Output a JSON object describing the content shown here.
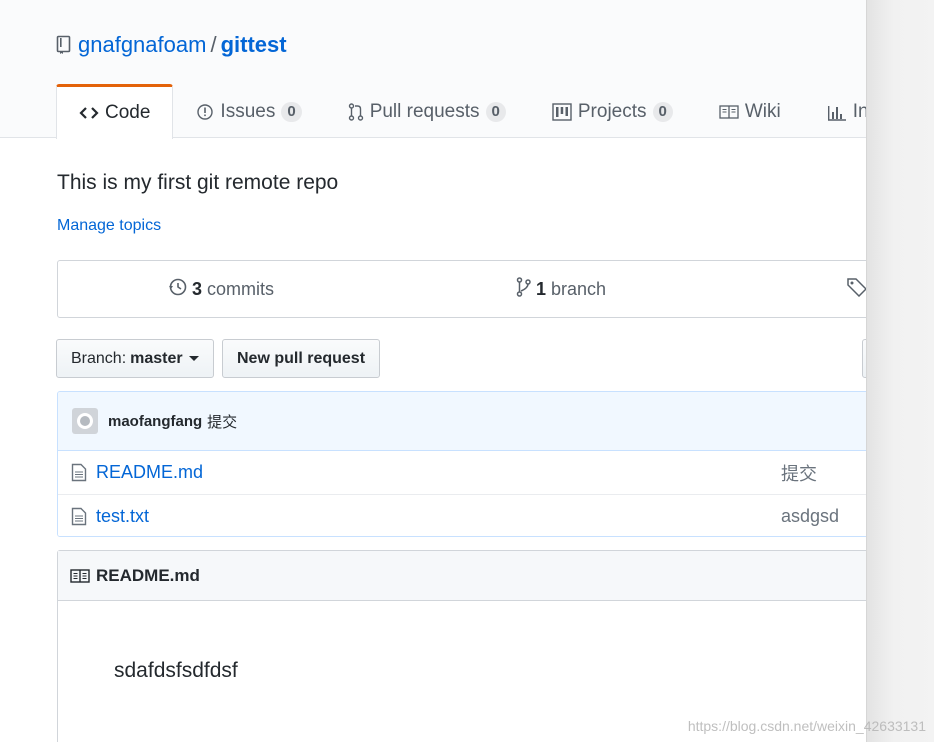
{
  "repo": {
    "owner": "gnafgnafoam",
    "separator": "/",
    "name": "gittest"
  },
  "tabs": [
    {
      "label": "Code",
      "icon": "code-icon",
      "count": null
    },
    {
      "label": "Issues",
      "icon": "issue-icon",
      "count": "0"
    },
    {
      "label": "Pull requests",
      "icon": "pull-request-icon",
      "count": "0"
    },
    {
      "label": "Projects",
      "icon": "project-icon",
      "count": "0"
    },
    {
      "label": "Wiki",
      "icon": "book-icon",
      "count": null
    },
    {
      "label": "Ins",
      "icon": "graph-icon",
      "count": null
    }
  ],
  "description": "This is my first git remote repo",
  "manage_topics": "Manage topics",
  "summary": {
    "commits_count": "3",
    "commits_label": "commits",
    "branch_count": "1",
    "branch_label": "branch"
  },
  "branch_button": {
    "prefix": "Branch:",
    "name": "master"
  },
  "new_pr_label": "New pull request",
  "latest_commit": {
    "author": "maofangfang",
    "message": "提交"
  },
  "files": [
    {
      "name": "README.md",
      "commit": "提交"
    },
    {
      "name": "test.txt",
      "commit": "asdgsd"
    }
  ],
  "readme": {
    "title": "README.md",
    "content": "sdafdsfsdfdsf"
  },
  "watermark": "https://blog.csdn.net/weixin_42633131",
  "colors": {
    "link": "#0366d6",
    "tab_accent": "#e36209",
    "header_bg": "#fafbfc"
  }
}
